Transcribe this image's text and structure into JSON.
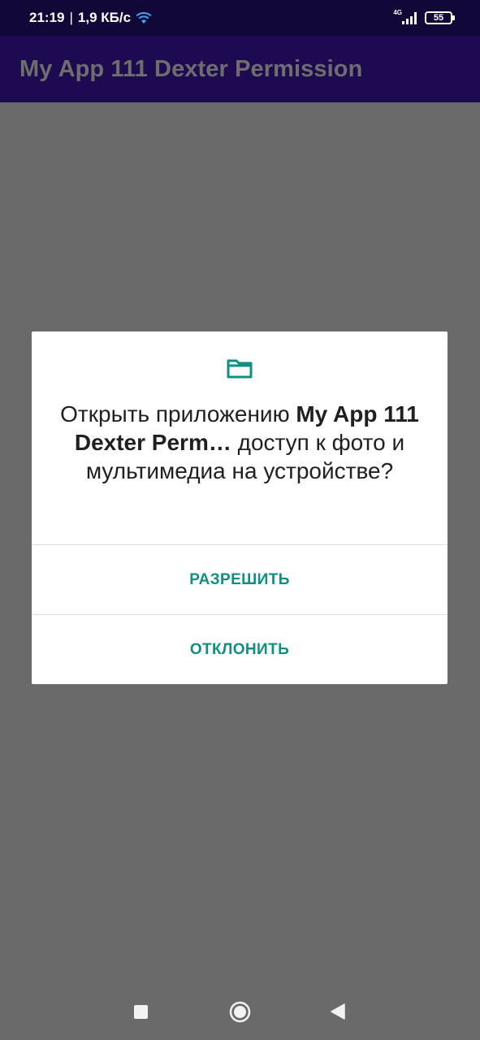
{
  "status_bar": {
    "time": "21:19",
    "separator": "|",
    "speed": "1,9 КБ/с",
    "network_type": "4G",
    "battery_level": "55",
    "icons": [
      "wifi-icon",
      "signal-icon",
      "battery-icon"
    ]
  },
  "app_bar": {
    "title": "My App 111 Dexter Permission"
  },
  "dialog": {
    "icon": "folder-icon",
    "message_prefix": "Открыть приложению ",
    "message_app_name": "My App 111 Dexter Perm…",
    "message_suffix": " доступ к фото и мультимедиа на устройстве?",
    "allow_label": "РАЗРЕШИТЬ",
    "deny_label": "ОТКЛОНИТЬ",
    "accent_color": "#0f8f82"
  },
  "nav_bar": {
    "icons": [
      "recents-icon",
      "home-icon",
      "back-icon"
    ]
  },
  "colors": {
    "status_bar": "#120838",
    "app_bar": "#1e0a50",
    "scrim": "#6a6a6a"
  }
}
